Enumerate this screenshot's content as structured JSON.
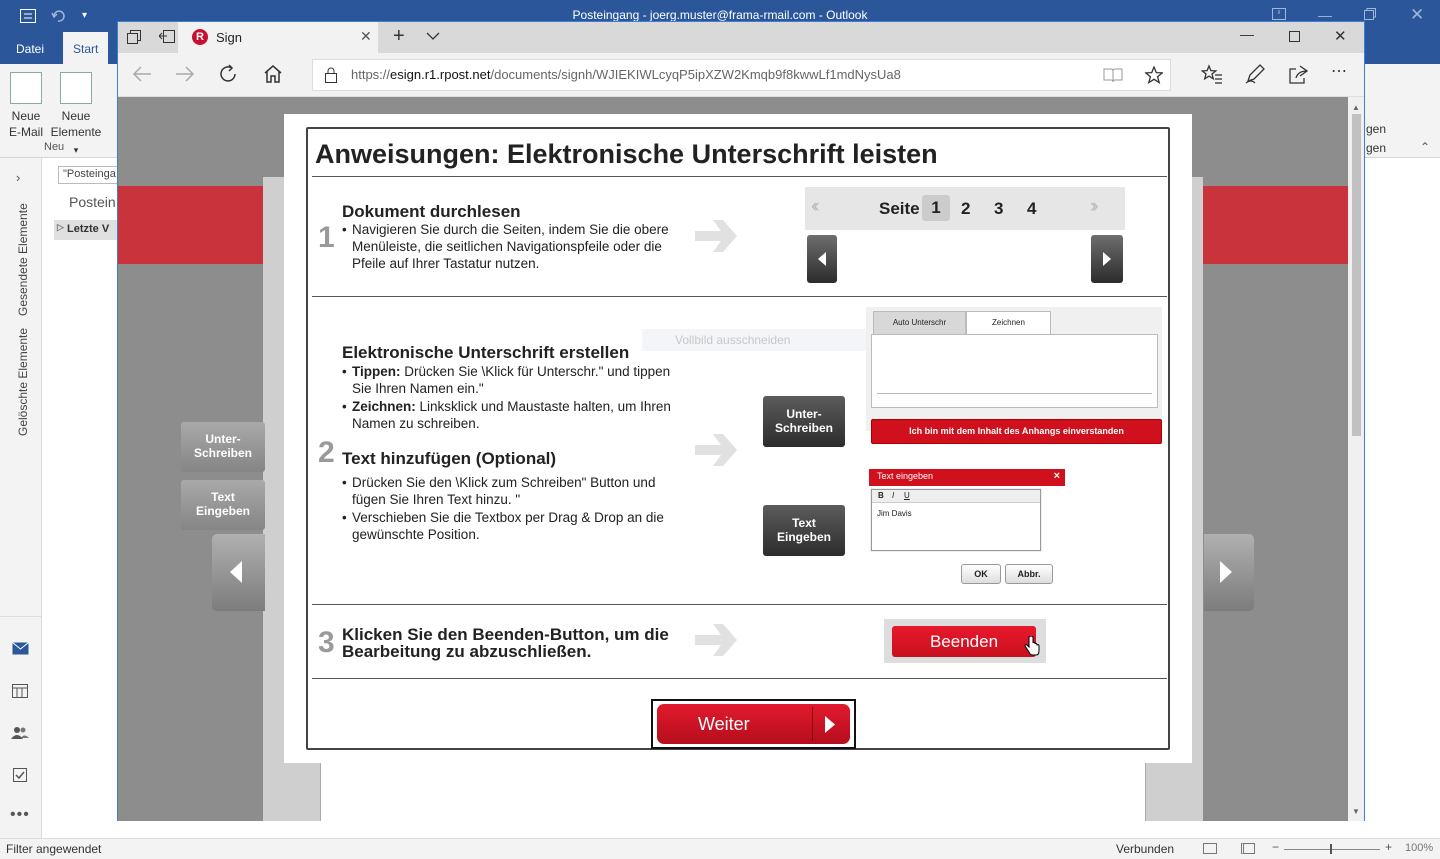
{
  "outlook": {
    "title": "Posteingang - joerg.muster@frama-rmail.com  -  Outlook",
    "tabs": [
      "Datei",
      "Start"
    ],
    "ribbon": {
      "new_email_line1": "Neue",
      "new_email_line2": "E-Mail",
      "new_items_line1": "Neue",
      "new_items_line2": "Elemente",
      "group_label": "Neu",
      "right_text_1": "gen",
      "right_text_2": "gen"
    },
    "search_placeholder": "\"Posteinga",
    "folder_header": "Postein",
    "folder_item": "Letzte V",
    "nav_sent": "Gesendete Elemente",
    "nav_deleted": "Gelöschte Elemente",
    "status_left": "Filter angewendet",
    "status_connected": "Verbunden",
    "zoom": "100%"
  },
  "edge": {
    "tab_title": "Sign",
    "url_host": "esign.r1.rpost.net",
    "url_prefix": "https://",
    "url_path": "/documents/signh/WJIEKIWLcyqP5ipXZW2Kmqb9f8kwwLf1mdNysUa8"
  },
  "page": {
    "side_btn_sign": "Unter-\nSchreiben",
    "side_btn_text": "Text\nEingeben",
    "ghost_text": "Vollbild ausschneiden"
  },
  "modal": {
    "title": "Anweisungen: Elektronische Unterschrift leisten",
    "step1": {
      "num": "1",
      "heading": "Dokument durchlesen",
      "bullet": "Navigieren Sie durch die Seiten, indem Sie die obere Menüleiste, die seitlichen Navigationspfeile oder die Pfeile auf Ihrer Tastatur nutzen.",
      "pager_label": "Seite",
      "pages": [
        "1",
        "2",
        "3",
        "4"
      ]
    },
    "step2": {
      "num": "2",
      "heading": "Elektronische Unterschrift erstellen",
      "bullet1_label": "Tippen:",
      "bullet1": " Drücken Sie \\Klick für Unterschr.\" und tippen Sie Ihren Namen ein.\"",
      "bullet2_label": "Zeichnen:",
      "bullet2": " Linksklick und Maustaste halten, um Ihren Namen zu schreiben.",
      "heading2": "Text hinzufügen (Optional)",
      "bullet3": "Drücken Sie den \\Klick zum Schreiben\" Button und fügen Sie Ihren Text hinzu. \"",
      "bullet4": "Verschieben Sie die Textbox per Drag & Drop an die gewünschte Position.",
      "btn_sign": "Unter-\nSchreiben",
      "btn_text": "Text\nEingeben",
      "sig_tab1": "Auto Unterschr",
      "sig_tab2": "Zeichnen",
      "sig_agree": "Ich bin mit dem Inhalt des Anhangs einverstanden",
      "text_dialog_title": "Text eingeben",
      "text_dialog_close": "×",
      "text_tool_b": "B",
      "text_tool_i": "I",
      "text_tool_u": "U",
      "text_dialog_value": "Jim Davis",
      "text_ok": "OK",
      "text_cancel": "Abbr."
    },
    "step3": {
      "num": "3",
      "heading": "Klicken Sie den Beenden-Button, um die Bearbeitung zu abzuschließen.",
      "finish_btn": "Beenden"
    },
    "next_button": "Weiter"
  },
  "colors": {
    "outlook_blue": "#2b579a",
    "accent_red": "#c8102e",
    "modal_border": "#444444"
  }
}
